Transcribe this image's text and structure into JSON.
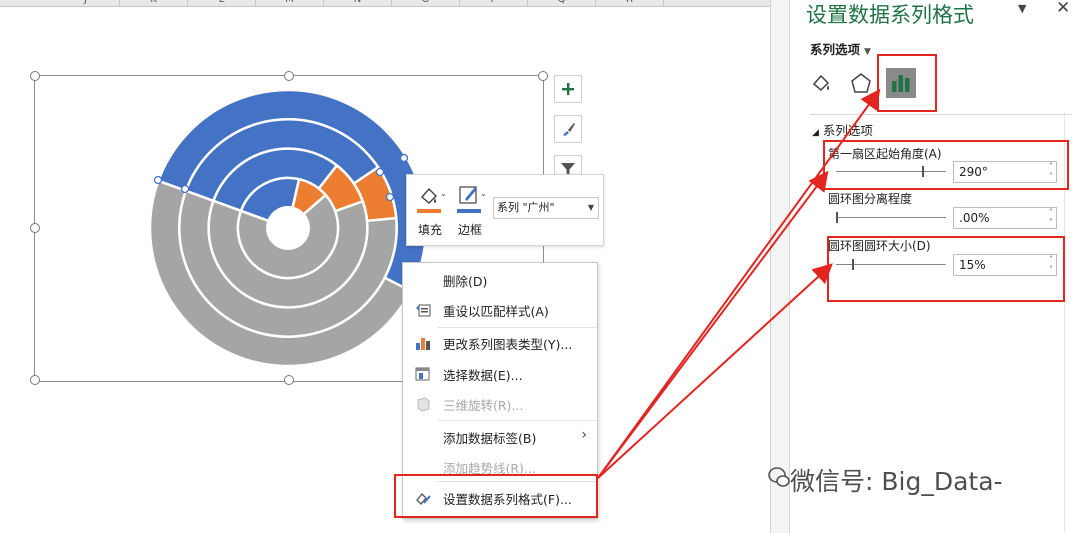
{
  "spreadsheet": {
    "columns": [
      "J",
      "K",
      "L",
      "M",
      "N",
      "O",
      "P",
      "Q",
      "R"
    ]
  },
  "chart": {
    "colors": {
      "blue": "#4472c4",
      "orange": "#ed7d31",
      "gray": "#a5a5a5"
    },
    "first_slice_angle_deg": 290,
    "hole_size_percent": 15,
    "rings": [
      {
        "blue_fraction": 0.52,
        "orange_fraction": 0.0
      },
      {
        "blue_fraction": 0.35,
        "orange_fraction": 0.08
      },
      {
        "blue_fraction": 0.3,
        "orange_fraction": 0.09
      },
      {
        "blue_fraction": 0.23,
        "orange_fraction": 0.1
      }
    ]
  },
  "chart_buttons": {
    "elements": "chart-elements-plus-icon",
    "styles": "chart-styles-brush-icon",
    "filters": "chart-filter-icon"
  },
  "mini_toolbar": {
    "fill_label": "填充",
    "outline_label": "边框",
    "series_selected": "系列 \"广州\""
  },
  "context_menu": {
    "items": [
      {
        "label": "删除(D)",
        "icon": "none",
        "enabled": true
      },
      {
        "label": "重设以匹配样式(A)",
        "icon": "reset-style-icon",
        "enabled": true
      },
      {
        "label": "更改系列图表类型(Y)...",
        "icon": "change-chart-type-icon",
        "enabled": true
      },
      {
        "label": "选择数据(E)...",
        "icon": "select-data-icon",
        "enabled": true
      },
      {
        "label": "三维旋转(R)...",
        "icon": "3d-rotation-icon",
        "enabled": false
      },
      {
        "label": "添加数据标签(B)",
        "icon": "none",
        "enabled": true,
        "submenu": true
      },
      {
        "label": "添加趋势线(R)...",
        "icon": "none",
        "enabled": false
      },
      {
        "label": "设置数据系列格式(F)...",
        "icon": "format-series-icon",
        "enabled": true
      }
    ]
  },
  "format_pane": {
    "title": "设置数据系列格式",
    "options_tab": "系列选项",
    "section_header": "系列选项",
    "first_slice_angle_label": "第一扇区起始角度(A)",
    "first_slice_angle_value": "290°",
    "first_slice_angle_fraction": 0.8,
    "explosion_label": "圆环图分离程度",
    "explosion_value": ".00%",
    "explosion_fraction": 0.0,
    "hole_size_label": "圆环图圆环大小(D)",
    "hole_size_value": "15%",
    "hole_size_fraction": 0.15
  },
  "watermark": {
    "text": "微信号: Big_Data-"
  }
}
